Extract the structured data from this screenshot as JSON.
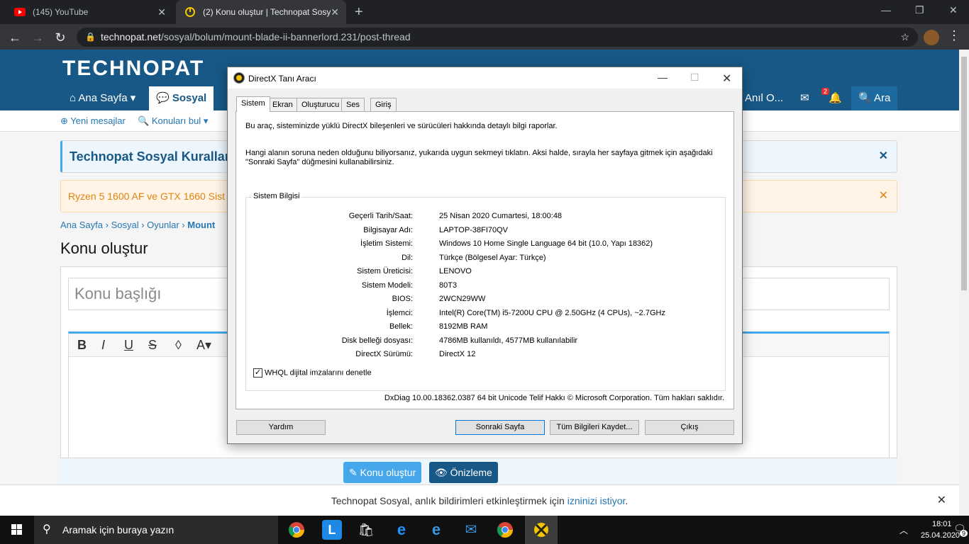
{
  "browser": {
    "tabs": [
      {
        "label": "(145) YouTube"
      },
      {
        "label": "(2) Konu oluştur | Technopat Sosy"
      }
    ],
    "url_host": "technopat.net",
    "url_path": "/sosyal/bolum/mount-blade-ii-bannerlord.231/post-thread"
  },
  "site": {
    "logo": "TECHNOPAT",
    "nav": {
      "home": "Ana Sayfa",
      "sosyal": "Sosyal",
      "user": "Anıl O...",
      "search": "Ara",
      "alert_count": "2"
    },
    "subnav": {
      "new_messages": "Yeni mesajlar",
      "find_threads": "Konuları bul"
    },
    "notice1": "Technopat Sosyal Kuralları",
    "notice2": "Ryzen 5 1600 AF ve GTX 1660 Sist",
    "breadcrumb": [
      "Ana Sayfa",
      "Sosyal",
      "Oyunlar",
      "Mount"
    ],
    "page_title": "Konu oluştur",
    "title_placeholder": "Konu başlığı",
    "buttons": {
      "create": "Konu oluştur",
      "preview": "Önizleme"
    },
    "push_text": "Technopat Sosyal, anlık bildirimleri etkinleştirmek için ",
    "push_link": "izninizi istiyor",
    "push_end": "."
  },
  "dxdiag": {
    "title": "DirectX Tanı Aracı",
    "tabs": [
      "Sistem",
      "Ekran",
      "Oluşturucu",
      "Ses",
      "Giriş"
    ],
    "intro1": "Bu araç, sisteminizde yüklü DirectX bileşenleri ve sürücüleri hakkında detaylı bilgi raporlar.",
    "intro2": "Hangi alanın soruna neden olduğunu biliyorsanız, yukarıda uygun sekmeyi tıklatın. Aksi halde, sırayla her sayfaya gitmek için aşağıdaki \"Sonraki Sayfa\" düğmesini kullanabilirsiniz.",
    "group_label": "Sistem Bilgisi",
    "rows": [
      {
        "label": "Geçerli Tarih/Saat:",
        "value": "25 Nisan 2020 Cumartesi, 18:00:48"
      },
      {
        "label": "Bilgisayar Adı:",
        "value": "LAPTOP-38FI70QV"
      },
      {
        "label": "İşletim Sistemi:",
        "value": "Windows 10 Home Single Language 64 bit (10.0, Yapı 18362)"
      },
      {
        "label": "Dil:",
        "value": "Türkçe (Bölgesel Ayar: Türkçe)"
      },
      {
        "label": "Sistem Üreticisi:",
        "value": "LENOVO"
      },
      {
        "label": "Sistem Modeli:",
        "value": "80T3"
      },
      {
        "label": "BIOS:",
        "value": "2WCN29WW"
      },
      {
        "label": "İşlemci:",
        "value": "Intel(R) Core(TM) i5-7200U CPU @ 2.50GHz (4 CPUs), ~2.7GHz"
      },
      {
        "label": "Bellek:",
        "value": "8192MB RAM"
      },
      {
        "label": "Disk belleği dosyası:",
        "value": "4786MB kullanıldı, 4577MB kullanılabilir"
      },
      {
        "label": "DirectX Sürümü:",
        "value": "DirectX 12"
      }
    ],
    "whql": "WHQL dijital imzalarını denetle",
    "whql_checked": true,
    "copyright": "DxDiag 10.00.18362.0387 64 bit Unicode  Telif Hakkı © Microsoft Corporation. Tüm hakları saklıdır.",
    "buttons": {
      "help": "Yardım",
      "next": "Sonraki Sayfa",
      "save": "Tüm Bilgileri Kaydet...",
      "exit": "Çıkış"
    }
  },
  "taskbar": {
    "search_placeholder": "Aramak için buraya yazın",
    "time": "18:01",
    "date": "25.04.2020",
    "notif_count": "9"
  },
  "colors": {
    "brand": "#185886",
    "accent": "#47a7eb",
    "chrome_dark": "#202124"
  }
}
